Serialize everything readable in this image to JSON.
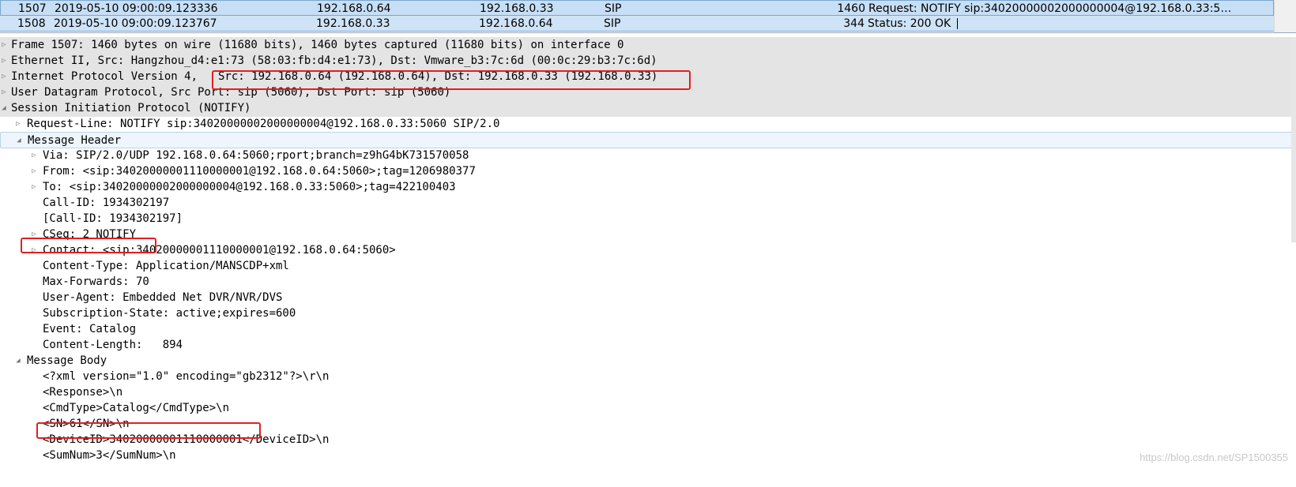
{
  "packet_list": {
    "rows": [
      {
        "no": "1507",
        "time": "2019-05-10 09:00:09.123336",
        "src": "192.168.0.64",
        "dst": "192.168.0.33",
        "proto": "SIP",
        "len": "1460",
        "info": "Request: NOTIFY sip:34020000002000000004@192.168.0.33:5…",
        "selected": true
      },
      {
        "no": "1508",
        "time": "2019-05-10 09:00:09.123767",
        "src": "192.168.0.33",
        "dst": "192.168.0.64",
        "proto": "SIP",
        "len": "344",
        "info": "Status: 200 OK",
        "selected": false
      }
    ]
  },
  "details": {
    "frame": "Frame 1507: 1460 bytes on wire (11680 bits), 1460 bytes captured (11680 bits) on interface 0",
    "ethernet": "Ethernet II, Src: Hangzhou_d4:e1:73 (58:03:fb:d4:e1:73), Dst: Vmware_b3:7c:6d (00:0c:29:b3:7c:6d)",
    "ip_prefix": "Internet Protocol Version 4,",
    "ip_rest": "Src: 192.168.0.64 (192.168.0.64), Dst: 192.168.0.33 (192.168.0.33)",
    "udp": "User Datagram Protocol, Src Port: sip (5060), Dst Port: sip (5060)",
    "sip": "Session Initiation Protocol (NOTIFY)",
    "request_line": "Request-Line: NOTIFY sip:34020000002000000004@192.168.0.33:5060 SIP/2.0",
    "message_header": "Message Header",
    "via": "Via: SIP/2.0/UDP 192.168.0.64:5060;rport;branch=z9hG4bK731570058",
    "from": "From: <sip:34020000001110000001@192.168.0.64:5060>;tag=1206980377",
    "to": "To: <sip:34020000002000000004@192.168.0.33:5060>;tag=422100403",
    "call_id": "Call-ID: 1934302197",
    "call_id_gen": "[Call-ID: 1934302197]",
    "cseq": "CSeq: 2 NOTIFY",
    "contact": "Contact: <sip:34020000001110000001@192.168.0.64:5060>",
    "content_type": "Content-Type: Application/MANSCDP+xml",
    "max_forwards": "Max-Forwards: 70",
    "user_agent": "User-Agent: Embedded Net DVR/NVR/DVS",
    "subscription_state": "Subscription-State: active;expires=600",
    "event": "Event: Catalog",
    "content_length": "Content-Length:   894",
    "message_body": "Message Body",
    "xml_decl": "<?xml version=\"1.0\" encoding=\"gb2312\"?>\\r\\n",
    "response_open": "<Response>\\n",
    "cmdtype": "<CmdType>Catalog</CmdType>\\n",
    "sn": "<SN>61</SN>\\n",
    "device_id": "<DeviceID>34020000001110000001</DeviceID>\\n",
    "sumnum": "<SumNum>3</SumNum>\\n"
  },
  "watermark": "https://blog.csdn.net/SP1500355",
  "colors": {
    "selected_row": "#c7dff5",
    "highlight_box": "#e02020",
    "gray_row": "#e4e4e4"
  }
}
